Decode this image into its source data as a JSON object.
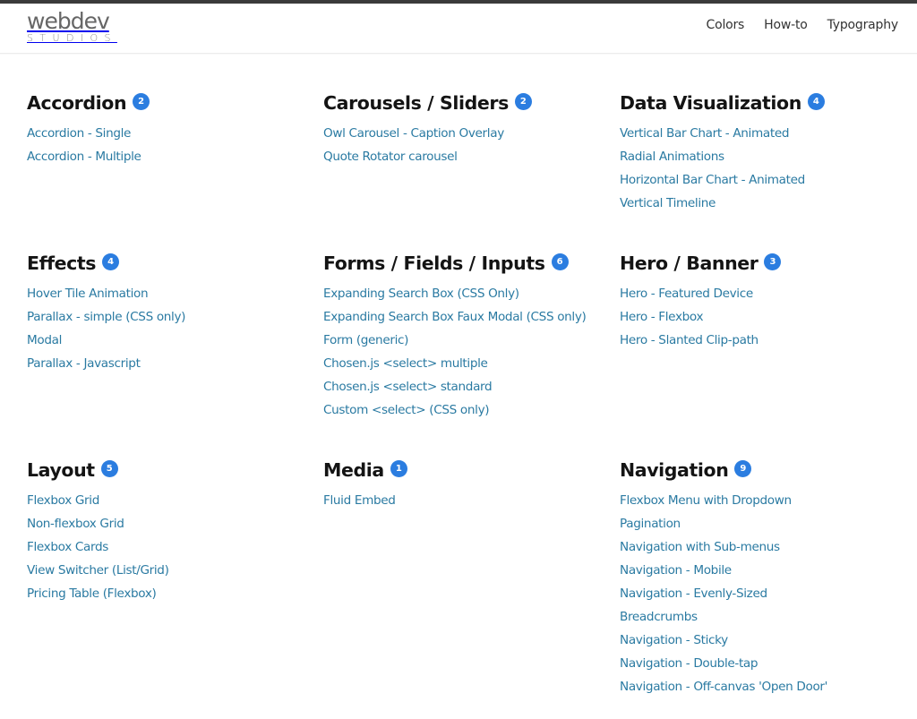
{
  "brand": {
    "logo_main": "webdev",
    "logo_sub": "STUDIOS"
  },
  "header": {
    "nav": [
      {
        "label": "Colors"
      },
      {
        "label": "How-to"
      },
      {
        "label": "Typography"
      }
    ]
  },
  "colors": {
    "topbar": "#3b3b3b",
    "link": "#2a7aa2",
    "badge": "#2b7de0",
    "heading": "#141414"
  },
  "sections": [
    {
      "title": "Accordion",
      "count": "2",
      "links": [
        "Accordion - Single",
        "Accordion - Multiple"
      ]
    },
    {
      "title": "Carousels / Sliders",
      "count": "2",
      "links": [
        "Owl Carousel - Caption Overlay",
        "Quote Rotator carousel"
      ]
    },
    {
      "title": "Data Visualization",
      "count": "4",
      "links": [
        "Vertical Bar Chart - Animated",
        "Radial Animations",
        "Horizontal Bar Chart - Animated",
        "Vertical Timeline"
      ]
    },
    {
      "title": "Effects",
      "count": "4",
      "links": [
        "Hover Tile Animation",
        "Parallax - simple (CSS only)",
        "Modal",
        "Parallax - Javascript"
      ]
    },
    {
      "title": "Forms / Fields / Inputs",
      "count": "6",
      "links": [
        "Expanding Search Box (CSS Only)",
        "Expanding Search Box Faux Modal (CSS only)",
        "Form (generic)",
        "Chosen.js <select> multiple",
        "Chosen.js <select> standard",
        "Custom <select> (CSS only)"
      ]
    },
    {
      "title": "Hero / Banner",
      "count": "3",
      "links": [
        "Hero - Featured Device",
        "Hero - Flexbox",
        "Hero - Slanted Clip-path"
      ]
    },
    {
      "title": "Layout",
      "count": "5",
      "links": [
        "Flexbox Grid",
        "Non-flexbox Grid",
        "Flexbox Cards",
        "View Switcher (List/Grid)",
        "Pricing Table (Flexbox)"
      ]
    },
    {
      "title": "Media",
      "count": "1",
      "links": [
        "Fluid Embed"
      ]
    },
    {
      "title": "Navigation",
      "count": "9",
      "links": [
        "Flexbox Menu with Dropdown",
        "Pagination",
        "Navigation with Sub-menus",
        "Navigation - Mobile",
        "Navigation - Evenly-Sized",
        "Breadcrumbs",
        "Navigation - Sticky",
        "Navigation - Double-tap",
        "Navigation - Off-canvas 'Open Door'"
      ]
    }
  ]
}
